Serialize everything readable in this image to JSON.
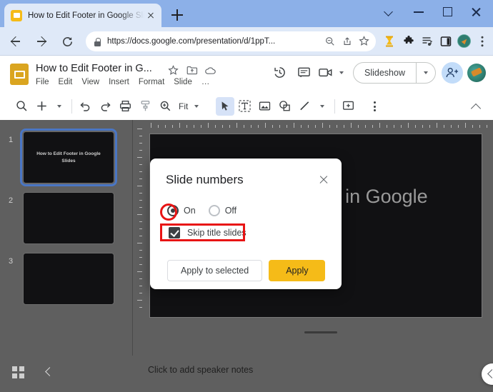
{
  "browser": {
    "tab": {
      "title": "How to Edit Footer in Google Slid",
      "favicon": "slides-favicon",
      "close": "×"
    },
    "new_tab_label": "+",
    "window_controls": [
      "chevron-down",
      "minimize",
      "maximize",
      "close"
    ],
    "nav": {
      "back": "back-arrow",
      "forward": "forward-arrow",
      "reload": "reload-icon"
    },
    "omnibox": {
      "url": "https://docs.google.com/presentation/d/1ppT...",
      "lock": "lock-icon",
      "icons": [
        "zoom-out-icon",
        "share-icon",
        "bookmark-star-icon"
      ]
    },
    "extensions": [
      "extension-gold-icon",
      "puzzle-piece-icon",
      "reading-list-icon",
      "side-panel-icon",
      "profile-avatar",
      "chrome-menu-icon"
    ]
  },
  "app": {
    "doc_title": "How to Edit Footer in G...",
    "title_icons": [
      "star-icon",
      "move-to-folder-icon",
      "cloud-saved-icon"
    ],
    "menus": [
      "File",
      "Edit",
      "View",
      "Insert",
      "Format",
      "Slide",
      "…"
    ],
    "header_right_icons": [
      "version-history-icon",
      "comment-icon",
      "meet-camera-icon"
    ],
    "slideshow": {
      "label": "Slideshow",
      "caret": "chevron-down-icon"
    },
    "share_icon": "person-add-icon",
    "account_avatar": "account-avatar"
  },
  "toolbar": {
    "zoom_label": "Fit",
    "items": [
      "search-icon",
      "new-slide-icon",
      "new-slide-caret",
      "undo-icon",
      "redo-icon",
      "print-icon",
      "paint-format-icon",
      "zoom-icon",
      "zoom-caret",
      "cursor-icon",
      "text-box-icon",
      "image-icon",
      "shape-icon",
      "line-icon",
      "line-caret",
      "comment-icon",
      "more-options-icon",
      "collapse-toolbar-icon"
    ]
  },
  "filmstrip": {
    "slides": [
      {
        "number": "1",
        "text": "How to Edit Footer in Google Slides",
        "selected": true
      },
      {
        "number": "2",
        "text": "",
        "selected": false
      },
      {
        "number": "3",
        "text": "",
        "selected": false
      }
    ]
  },
  "canvas": {
    "slide_title": "How to Edit Footer in Google Slides"
  },
  "dialog": {
    "title": "Slide numbers",
    "close_label": "×",
    "options": [
      {
        "label": "On",
        "checked": true
      },
      {
        "label": "Off",
        "checked": false
      }
    ],
    "checkbox": {
      "label": "Skip title slides",
      "checked": true
    },
    "buttons": {
      "secondary": "Apply to selected",
      "primary": "Apply"
    },
    "annotations": {
      "radio_circle_color": "#e81414",
      "checkbox_rect_color": "#e81414"
    }
  },
  "bottom": {
    "grid_view_icon": "grid-view-icon",
    "collapse_icon": "collapse-filmstrip-icon",
    "speaker_notes_placeholder": "Click to add speaker notes",
    "expand_panel_icon": "expand-panel-icon"
  },
  "colors": {
    "titlebar": "#8cb0e8",
    "addressbar": "#dfe9f8",
    "workspace": "#5f5f5f",
    "primary_button": "#f5bb18",
    "slide_bg": "#111113",
    "annotation": "#e81414",
    "selection_border": "#4a76c4"
  }
}
